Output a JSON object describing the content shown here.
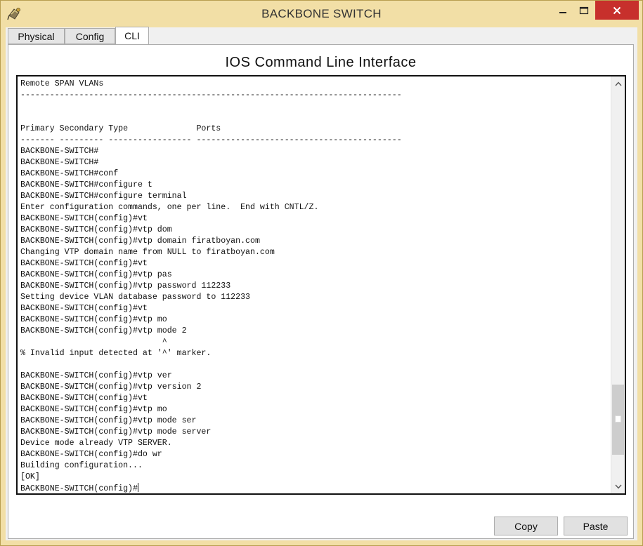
{
  "window": {
    "title": "BACKBONE SWITCH",
    "icon": "packet-tracer-device-icon",
    "controls": {
      "minimize": "minimize-icon",
      "maximize": "maximize-icon",
      "close": "close-icon"
    }
  },
  "tabs": [
    {
      "label": "Physical",
      "active": false
    },
    {
      "label": "Config",
      "active": false
    },
    {
      "label": "CLI",
      "active": true
    }
  ],
  "cli": {
    "heading": "IOS Command Line Interface",
    "lines": [
      "Remote SPAN VLANs",
      "------------------------------------------------------------------------------",
      "",
      "",
      "Primary Secondary Type              Ports",
      "------- --------- ----------------- ------------------------------------------",
      "BACKBONE-SWITCH#",
      "BACKBONE-SWITCH#",
      "BACKBONE-SWITCH#conf",
      "BACKBONE-SWITCH#configure t",
      "BACKBONE-SWITCH#configure terminal",
      "Enter configuration commands, one per line.  End with CNTL/Z.",
      "BACKBONE-SWITCH(config)#vt",
      "BACKBONE-SWITCH(config)#vtp dom",
      "BACKBONE-SWITCH(config)#vtp domain firatboyan.com",
      "Changing VTP domain name from NULL to firatboyan.com",
      "BACKBONE-SWITCH(config)#vt",
      "BACKBONE-SWITCH(config)#vtp pas",
      "BACKBONE-SWITCH(config)#vtp password 112233",
      "Setting device VLAN database password to 112233",
      "BACKBONE-SWITCH(config)#vt",
      "BACKBONE-SWITCH(config)#vtp mo",
      "BACKBONE-SWITCH(config)#vtp mode 2",
      "                             ^",
      "% Invalid input detected at '^' marker.",
      "",
      "BACKBONE-SWITCH(config)#vtp ver",
      "BACKBONE-SWITCH(config)#vtp version 2",
      "BACKBONE-SWITCH(config)#vt",
      "BACKBONE-SWITCH(config)#vtp mo",
      "BACKBONE-SWITCH(config)#vtp mode ser",
      "BACKBONE-SWITCH(config)#vtp mode server",
      "Device mode already VTP SERVER.",
      "BACKBONE-SWITCH(config)#do wr",
      "Building configuration...",
      "[OK]"
    ],
    "prompt": "BACKBONE-SWITCH(config)#",
    "scroll_position": 0.92
  },
  "buttons": {
    "copy": "Copy",
    "paste": "Paste"
  }
}
